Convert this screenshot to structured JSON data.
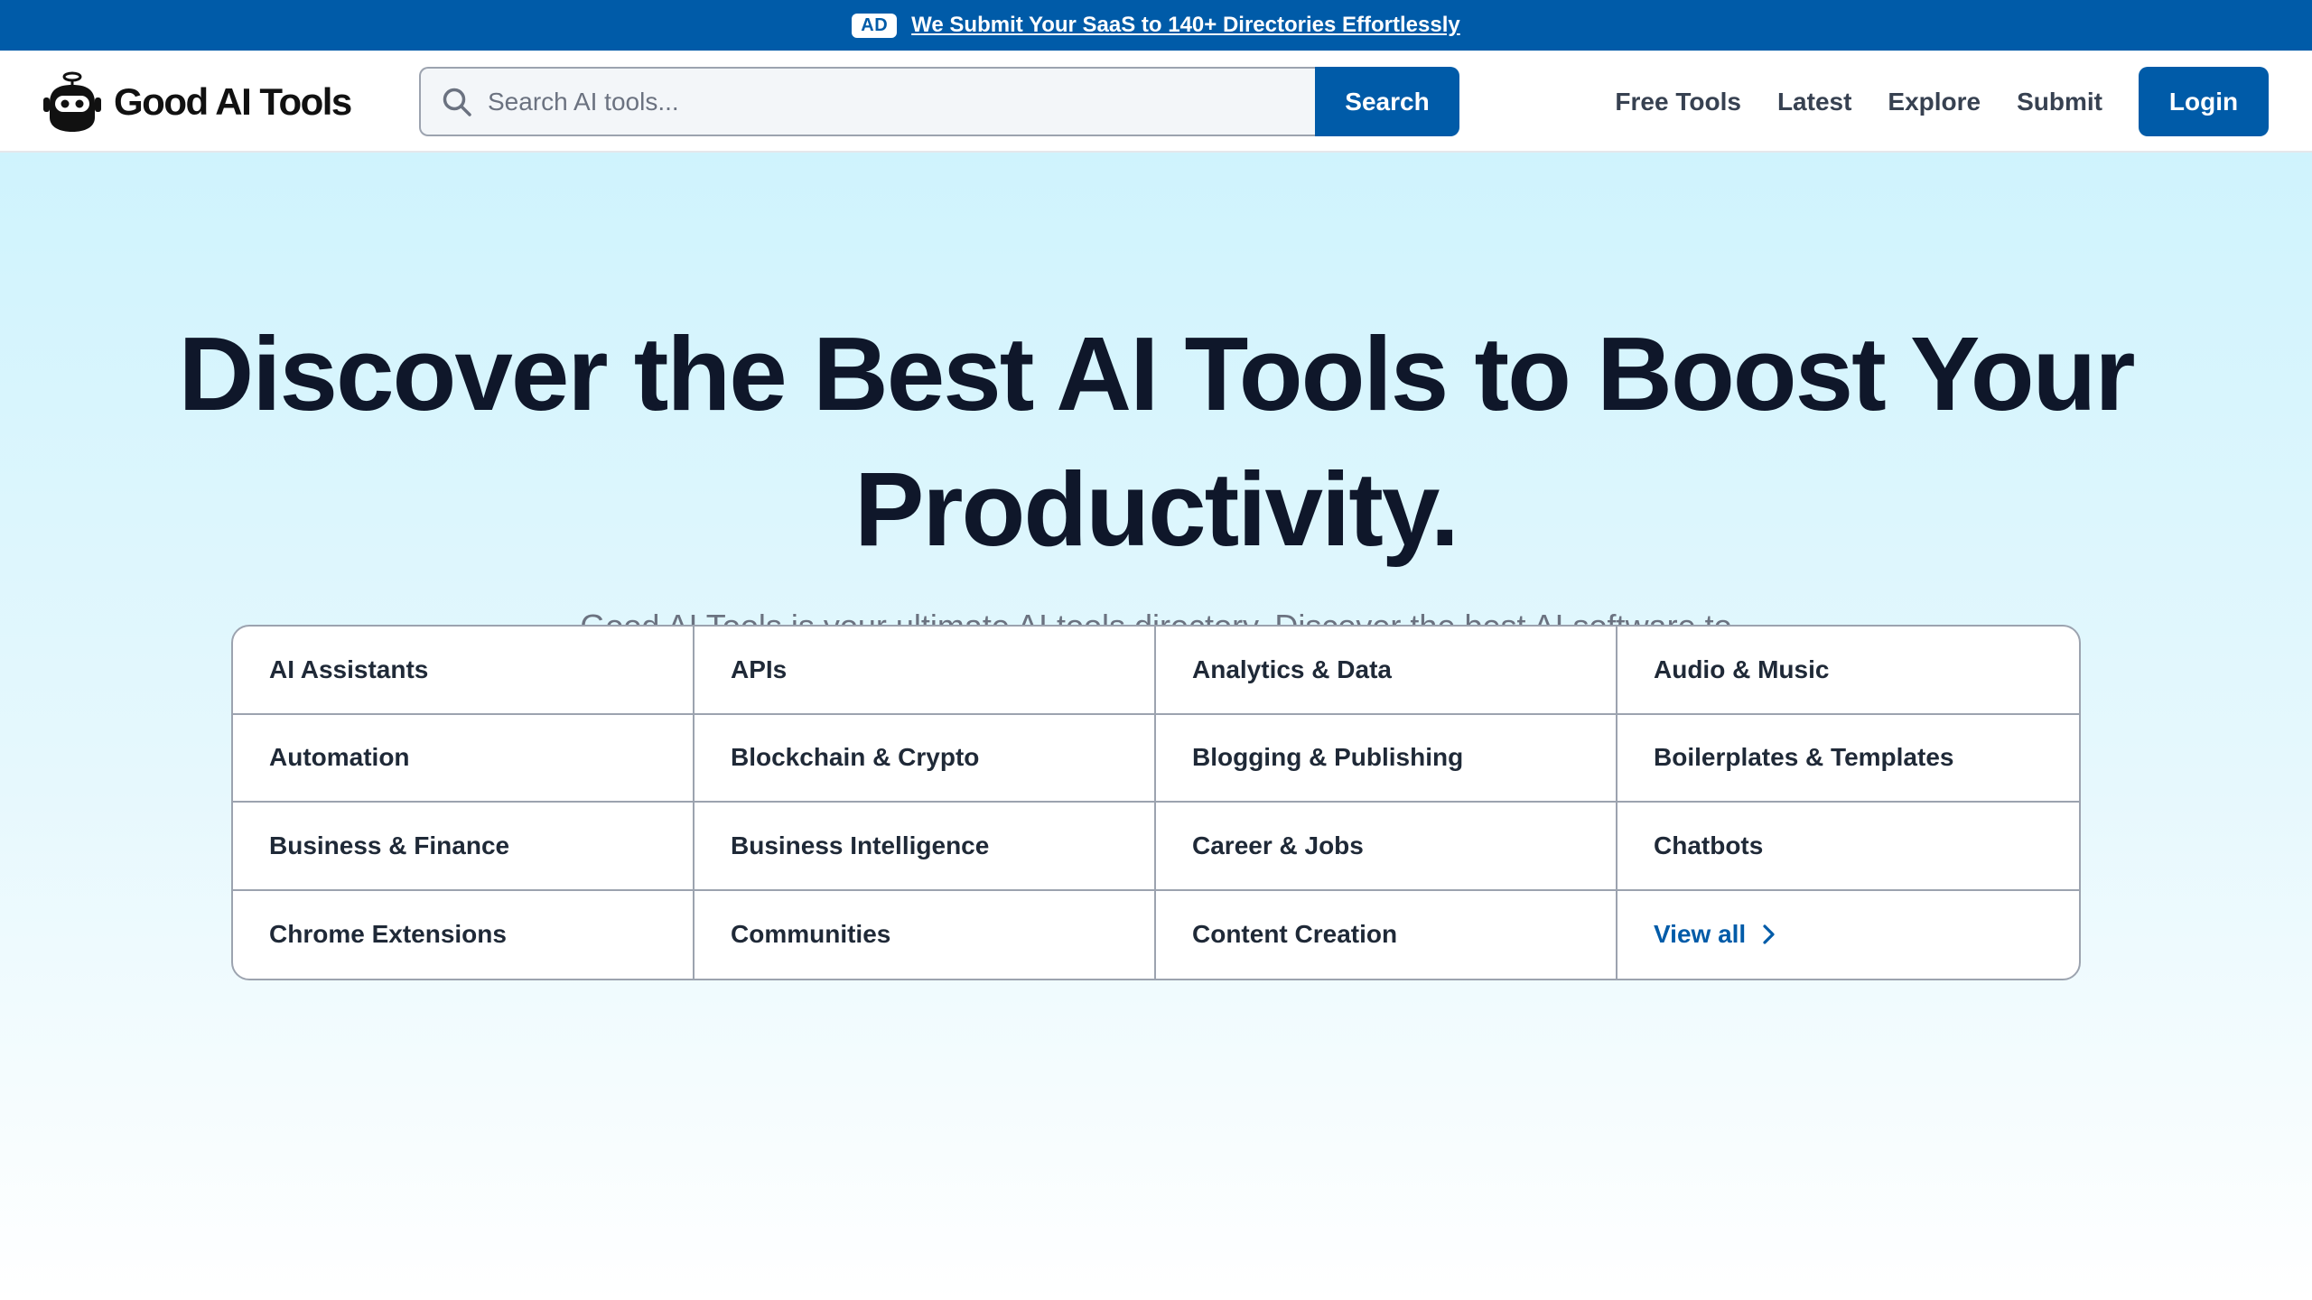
{
  "colors": {
    "brand": "#005ba8",
    "heading": "#0f172a",
    "muted": "#6b7280",
    "hero_bg_top": "#cff3fd"
  },
  "ad": {
    "badge": "AD",
    "text": "We Submit Your SaaS to 140+ Directories Effortlessly"
  },
  "header": {
    "logo_text": "Good AI Tools",
    "logo_icon": "robot-icon",
    "search": {
      "placeholder": "Search AI tools...",
      "value": "",
      "button_label": "Search",
      "icon": "search-icon"
    },
    "nav": [
      {
        "label": "Free Tools"
      },
      {
        "label": "Latest"
      },
      {
        "label": "Explore"
      },
      {
        "label": "Submit"
      }
    ],
    "login_label": "Login"
  },
  "hero": {
    "title": "Discover the Best AI Tools to Boost Your Productivity.",
    "subtitle": "Good AI Tools is your ultimate AI tools directory. Discover the best AI software to boost your productivity and workflow."
  },
  "categories": [
    "AI Assistants",
    "APIs",
    "Analytics & Data",
    "Audio & Music",
    "Automation",
    "Blockchain & Crypto",
    "Blogging & Publishing",
    "Boilerplates & Templates",
    "Business & Finance",
    "Business Intelligence",
    "Career & Jobs",
    "Chatbots",
    "Chrome Extensions",
    "Communities",
    "Content Creation"
  ],
  "view_all": {
    "label": "View all",
    "icon": "chevron-right-icon"
  }
}
